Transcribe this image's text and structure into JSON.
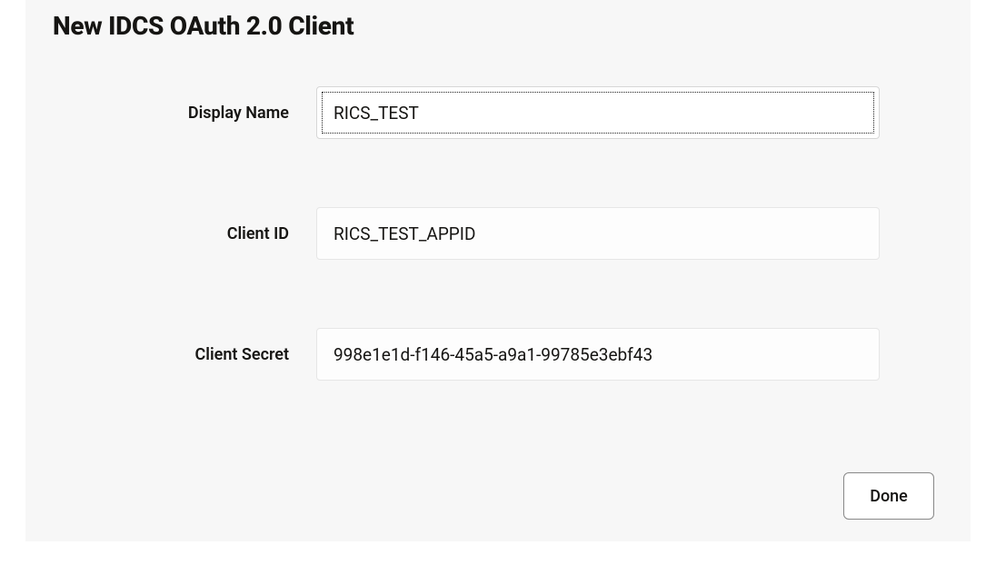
{
  "dialog": {
    "title": "New IDCS OAuth 2.0 Client"
  },
  "form": {
    "display_name": {
      "label": "Display Name",
      "value": "RICS_TEST"
    },
    "client_id": {
      "label": "Client ID",
      "value": "RICS_TEST_APPID"
    },
    "client_secret": {
      "label": "Client Secret",
      "value": "998e1e1d-f146-45a5-a9a1-99785e3ebf43"
    }
  },
  "buttons": {
    "done": "Done"
  }
}
